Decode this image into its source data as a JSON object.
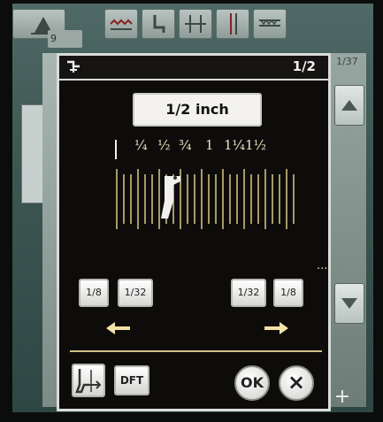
{
  "background": {
    "badge_text": "9",
    "page_indicator": "1/37"
  },
  "dialog": {
    "page_indicator": "1/2",
    "value_display": "1/2 inch",
    "scale_labels": [
      "¼",
      "½",
      "¾",
      "1",
      "1¼",
      "1½"
    ],
    "ellipsis": "...",
    "left_buttons": [
      "1/8",
      "1/32"
    ],
    "right_buttons": [
      "1/32",
      "1/8"
    ],
    "dft_label": "DFT",
    "ok_label": "OK",
    "cancel_label": "×"
  },
  "colors": {
    "scale_lines": "#d8c98a",
    "arrow": "#f2e2a8",
    "dialog_border": "#d9dcd8"
  }
}
